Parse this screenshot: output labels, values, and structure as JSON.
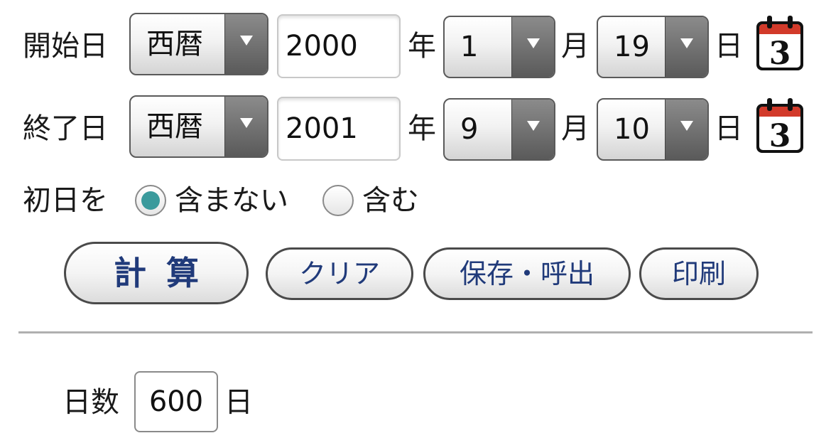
{
  "start": {
    "label": "開始日",
    "era": "西暦",
    "year": "2000",
    "year_unit": "年",
    "month": "1",
    "month_unit": "月",
    "day": "19",
    "day_unit": "日"
  },
  "end": {
    "label": "終了日",
    "era": "西暦",
    "year": "2001",
    "year_unit": "年",
    "month": "9",
    "month_unit": "月",
    "day": "10",
    "day_unit": "日"
  },
  "first_day": {
    "label": "初日を",
    "options": [
      {
        "label": "含まない",
        "selected": true
      },
      {
        "label": "含む",
        "selected": false
      }
    ]
  },
  "buttons": {
    "calculate": "計算",
    "clear": "クリア",
    "save_load": "保存・呼出",
    "print": "印刷"
  },
  "result": {
    "label": "日数",
    "value": "600",
    "unit": "日"
  },
  "icons": {
    "calendar": "calendar-icon"
  },
  "colors": {
    "button_text": "#203a7a",
    "radio_selected": "#3a9a9c",
    "calendar_red": "#d23a2a"
  }
}
